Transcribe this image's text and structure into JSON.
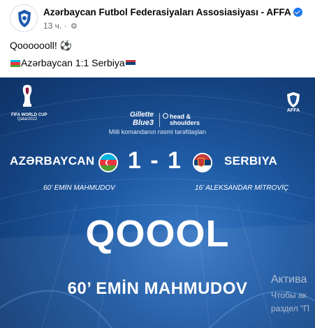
{
  "post": {
    "page_name": "Azərbaycan Futbol Federasiyaları Assosiasiyası - AFFA",
    "time": "13 ч.",
    "privacy_icon": "gear-icon",
    "more_icon": "more-options-icon",
    "text_line1": "Qooooooll!",
    "text_line1_emoji": "⚽",
    "text_line2": "Azərbaycan 1:1 Serbiya"
  },
  "graphic": {
    "wc_label_top": "FIFA WORLD CUP",
    "wc_label_bottom": "Qatar2022",
    "affa_label": "AFFA",
    "sponsor_brand1_line1": "Gillette",
    "sponsor_brand1_line2": "Blue3",
    "sponsor_brand2": "head & shoulders",
    "sponsor_note": "Milli komandanın rəsmi tərəfdaşları",
    "team_home": "AZƏRBAYCAN",
    "team_away": "SERBIYA",
    "score_display": "1 - 1",
    "scorer_home": "60’ EMİN MAHMUDOV",
    "scorer_away": "16’ ALEKSANDAR MİTROVİÇ",
    "big_goal_text": "QOOOL",
    "big_scorer_text": "60’ EMİN MAHMUDOV"
  },
  "watermark": {
    "line1": "Актива",
    "line2": "Чтобы ак",
    "line3": "раздел \"П"
  },
  "colors": {
    "bg_dark": "#0e3266",
    "bg_light": "#3a79c5",
    "verified": "#1877f2",
    "az_blue": "#00b5e2",
    "az_red": "#ef3340",
    "az_green": "#509e2f",
    "rs_red": "#c6363c",
    "rs_blue": "#0c4076"
  }
}
